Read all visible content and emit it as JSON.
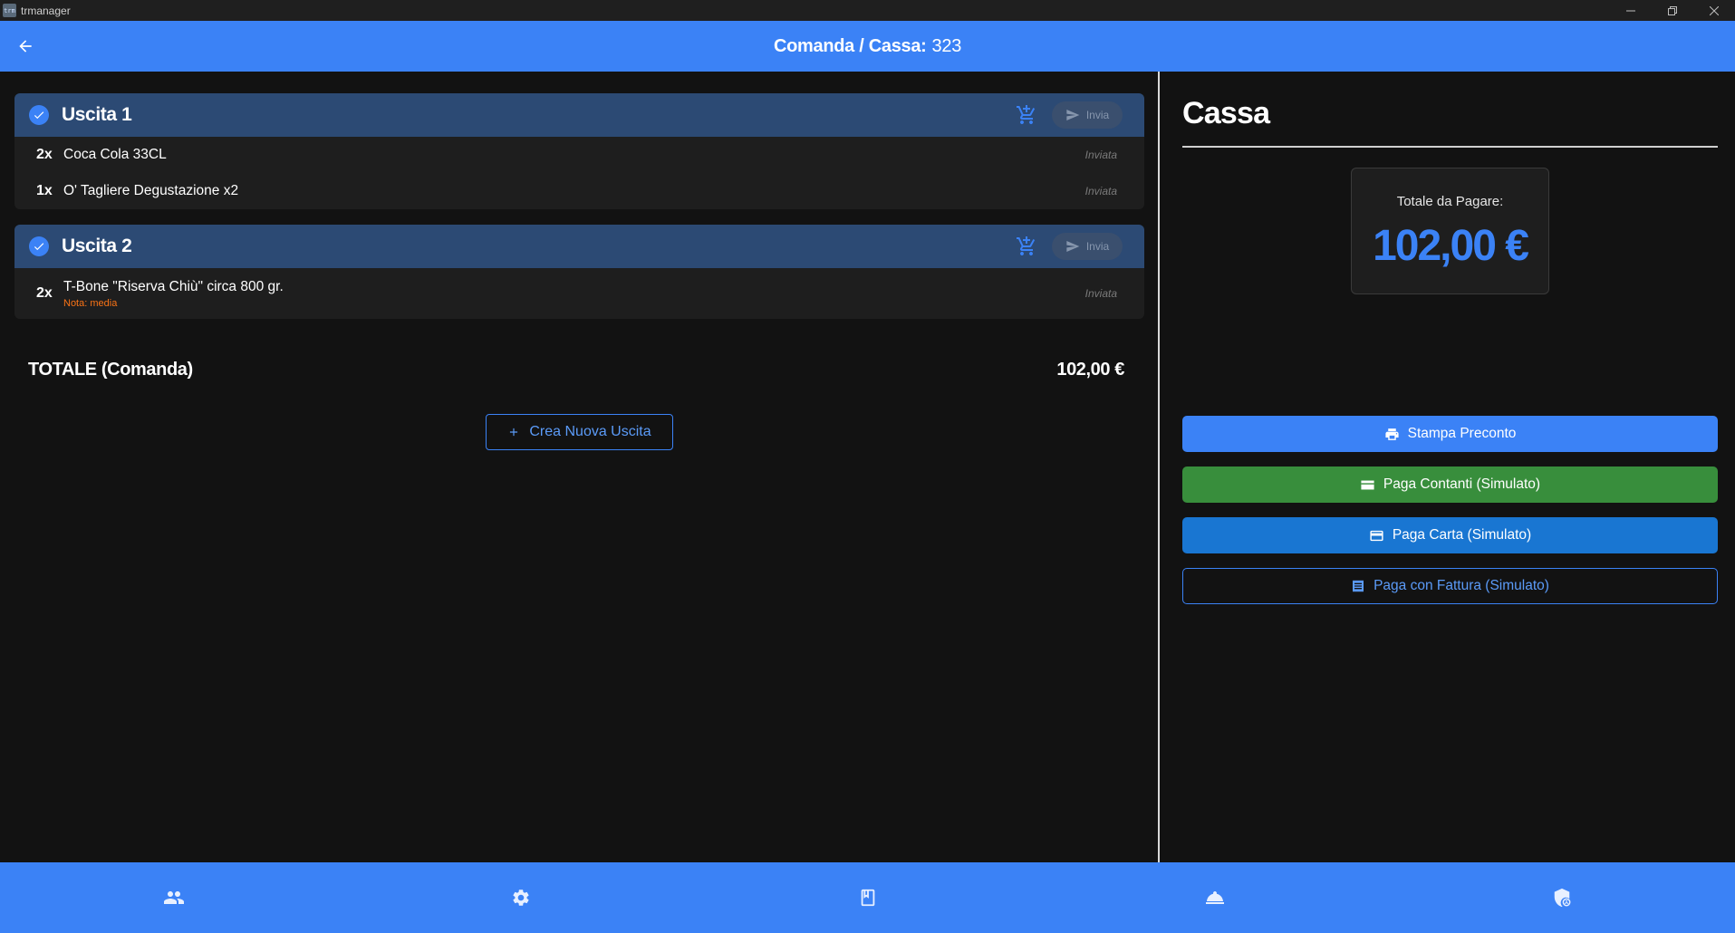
{
  "window": {
    "app_name": "trmanager",
    "icon_text": "trm"
  },
  "header": {
    "title": "Comanda / Cassa:",
    "order_number": "323"
  },
  "uscite": [
    {
      "title": "Uscita 1",
      "send_label": "Invia",
      "items": [
        {
          "qty": "2x",
          "name": "Coca Cola 33CL",
          "note": "",
          "status": "Inviata"
        },
        {
          "qty": "1x",
          "name": "O' Tagliere Degustazione x2",
          "note": "",
          "status": "Inviata"
        }
      ]
    },
    {
      "title": "Uscita 2",
      "send_label": "Invia",
      "items": [
        {
          "qty": "2x",
          "name": "T-Bone \"Riserva Chiù\" circa 800 gr.",
          "note": "Nota: media",
          "status": "Inviata"
        }
      ]
    }
  ],
  "totale": {
    "label": "TOTALE (Comanda)",
    "value": "102,00 €"
  },
  "new_uscita_label": "Crea Nuova Uscita",
  "cassa": {
    "title": "Cassa",
    "total_label": "Totale da Pagare:",
    "total_value": "102,00 €",
    "actions": {
      "preconto": "Stampa Preconto",
      "contanti": "Paga Contanti (Simulato)",
      "carta": "Paga Carta (Simulato)",
      "fattura": "Paga con Fattura (Simulato)"
    }
  },
  "bottom_nav": [
    "people-icon",
    "settings-icon",
    "menu-book-icon",
    "room-service-icon",
    "admin-shield-icon"
  ],
  "colors": {
    "primary": "#3b82f6",
    "uscita_header": "#2c4a74",
    "cash_green": "#388e3c",
    "card_blue": "#1976d2",
    "note_orange": "#f97316"
  }
}
